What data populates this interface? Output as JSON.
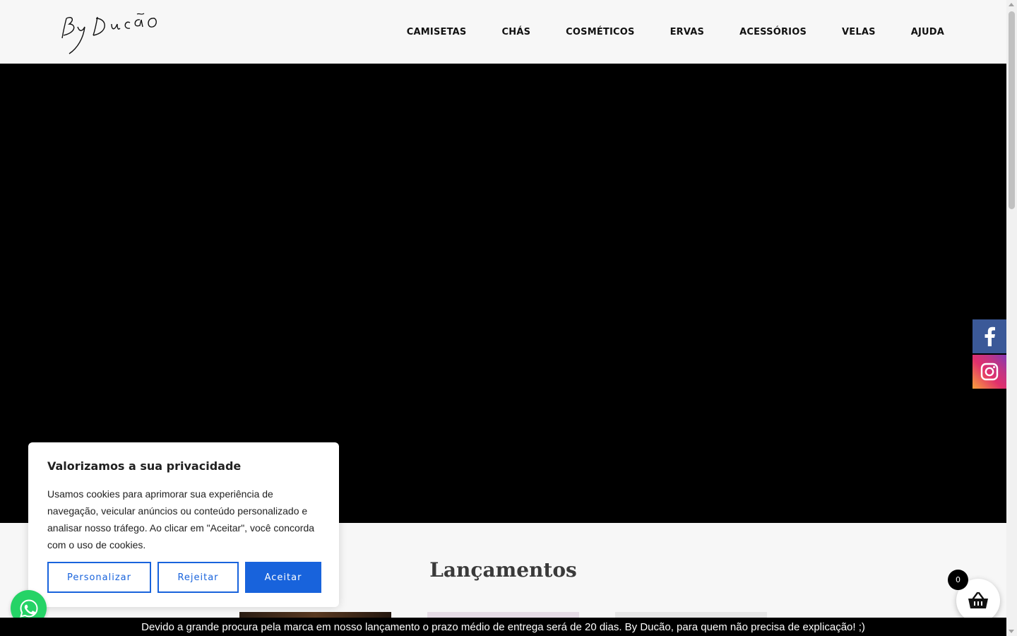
{
  "header": {
    "logo_text": "By Ducão",
    "nav": [
      "CAMISETAS",
      "CHÁS",
      "COSMÉTICOS",
      "ERVAS",
      "ACESSÓRIOS",
      "VELAS",
      "AJUDA"
    ]
  },
  "social": {
    "icons": [
      "facebook-icon",
      "instagram-icon"
    ],
    "colors": {
      "facebook": "#3b5998",
      "instagram": "#e1306c"
    }
  },
  "section": {
    "title": "Lançamentos"
  },
  "cookie": {
    "title": "Valorizamos a sua privacidade",
    "text": "Usamos cookies para aprimorar sua experiência de navegação, veicular anúncios ou conteúdo personalizado e analisar nosso tráfego. Ao clicar em \"Aceitar\", você concorda com o uso de cookies.",
    "customize": "Personalizar",
    "reject": "Rejeitar",
    "accept": "Aceitar",
    "accent": "#1863dc"
  },
  "cart": {
    "count": "0"
  },
  "notice": {
    "text": "Devido a grande procura pela marca em nosso lançamento o prazo médio de entrega será de 20 dias. By Ducão, para quem não precisa de explicação! ;)"
  }
}
